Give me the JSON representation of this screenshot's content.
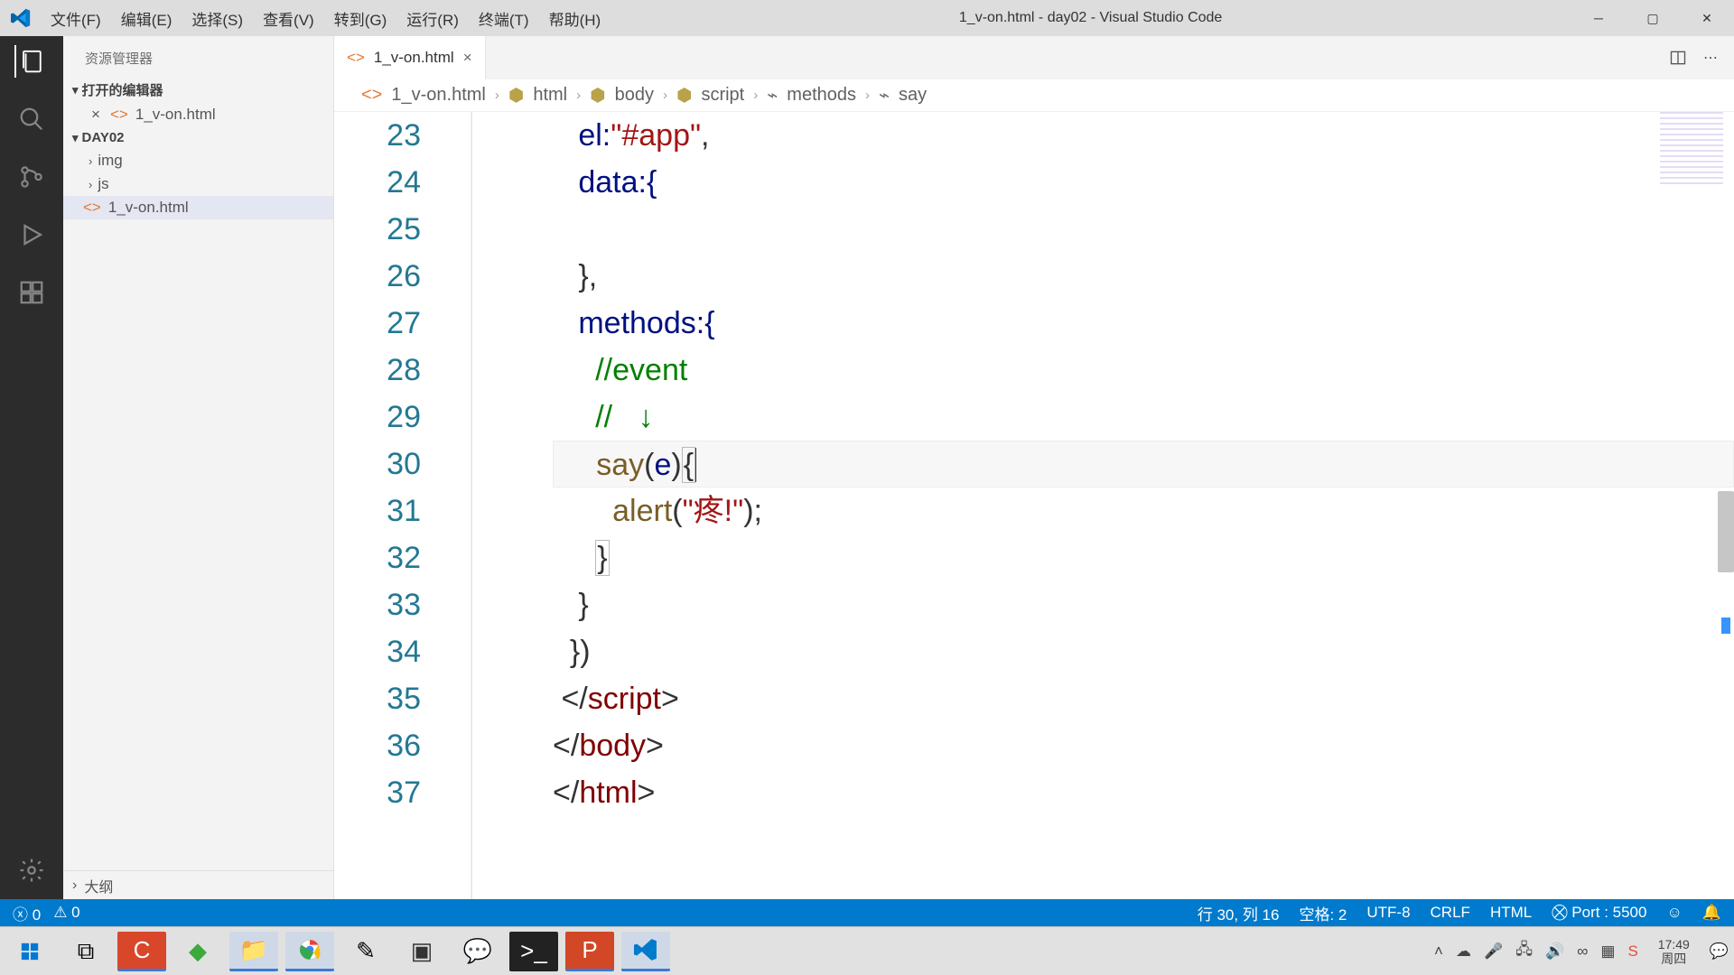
{
  "menu": {
    "file": "文件(F)",
    "edit": "编辑(E)",
    "select": "选择(S)",
    "view": "查看(V)",
    "go": "转到(G)",
    "run": "运行(R)",
    "terminal": "终端(T)",
    "help": "帮助(H)"
  },
  "window_title": "1_v-on.html - day02 - Visual Studio Code",
  "sidebar": {
    "header": "资源管理器",
    "open_editors": "打开的编辑器",
    "open_file": "1_v-on.html",
    "project": "DAY02",
    "folders": {
      "img": "img",
      "js": "js"
    },
    "tree_file": "1_v-on.html",
    "outline": "大纲"
  },
  "tab": {
    "name": "1_v-on.html"
  },
  "breadcrumb": {
    "file": "1_v-on.html",
    "p1": "html",
    "p2": "body",
    "p3": "script",
    "p4": "methods",
    "p5": "say"
  },
  "gutter": [
    "23",
    "24",
    "25",
    "26",
    "27",
    "28",
    "29",
    "30",
    "31",
    "32",
    "33",
    "34",
    "35",
    "36",
    "37"
  ],
  "code": {
    "l23_a": "el:",
    "l23_b": "\"#app\"",
    "l23_c": ",",
    "l24_a": "data:{",
    "l26_a": "},",
    "l27_a": "methods:{",
    "l28_a": "//event",
    "l29_a": "//   ↓",
    "l30_a": "say",
    "l30_b": "(",
    "l30_c": "e",
    "l30_d": ")",
    "l30_e": "{",
    "l31_a": "alert",
    "l31_b": "(",
    "l31_c": "\"疼!\"",
    "l31_d": ");",
    "l32_a": "}",
    "l33_a": "}",
    "l34_a": "})",
    "l35_a": "</",
    "l35_b": "script",
    "l35_c": ">",
    "l36_a": "</",
    "l36_b": "body",
    "l36_c": ">",
    "l37_a": "</",
    "l37_b": "html",
    "l37_c": ">"
  },
  "status": {
    "errors": "0",
    "warnings": "0",
    "ln_col": "行 30, 列 16",
    "spaces": "空格: 2",
    "encoding": "UTF-8",
    "eol": "CRLF",
    "lang": "HTML",
    "port": "Port : 5500"
  },
  "clock": {
    "time": "17:49",
    "date": "周四"
  }
}
